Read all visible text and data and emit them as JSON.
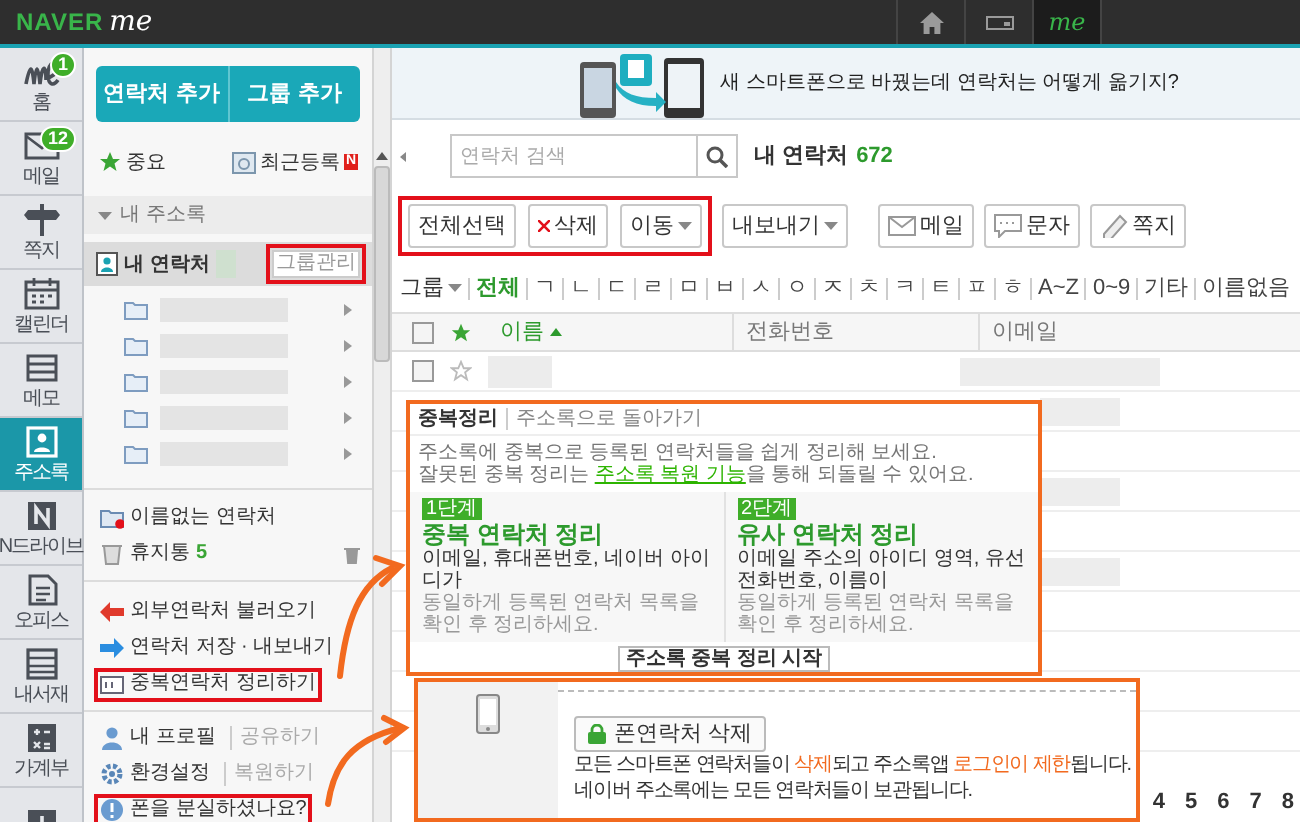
{
  "top_bar": {
    "logo": "NAVER",
    "logo_mark": "me",
    "nav": [
      {
        "kind": "home",
        "selected": false
      },
      {
        "kind": "card",
        "selected": false
      },
      {
        "kind": "me",
        "label": "me",
        "selected": true
      }
    ]
  },
  "nav_rail": [
    {
      "kind": "me",
      "label": "홈",
      "badge": "1",
      "selected": false
    },
    {
      "kind": "mail",
      "label": "메일",
      "badge": "12",
      "selected": false
    },
    {
      "kind": "note",
      "label": "쪽지",
      "selected": false
    },
    {
      "kind": "calendar",
      "label": "캘린더",
      "selected": false
    },
    {
      "kind": "memo",
      "label": "메모",
      "selected": false
    },
    {
      "kind": "contacts",
      "label": "주소록",
      "selected": true
    },
    {
      "kind": "drive",
      "label": "N드라이브",
      "selected": false
    },
    {
      "kind": "office",
      "label": "오피스",
      "selected": false
    },
    {
      "kind": "library",
      "label": "내서재",
      "selected": false
    },
    {
      "kind": "ledger",
      "label": "가계부",
      "selected": false
    },
    {
      "kind": "plus",
      "selected": false
    }
  ],
  "sidebar": {
    "buttons": [
      "연락처 추가",
      "그룹 추가"
    ],
    "quick": [
      {
        "kind": "star",
        "label": "중요"
      },
      {
        "kind": "recent",
        "label": "최근등록",
        "badge": "N"
      }
    ],
    "address_book": {
      "title": "내 주소록",
      "expanded": true,
      "items": [
        {
          "label": "내 연락처",
          "selected": true,
          "action": "그룹관리",
          "highlighted": true
        }
      ],
      "groups": [
        {
          "kind": "blurred"
        },
        {
          "kind": "blurred"
        },
        {
          "kind": "blurred"
        },
        {
          "kind": "blurred"
        },
        {
          "kind": "blurred"
        }
      ]
    },
    "special": [
      {
        "kind": "unnamed",
        "label": "이름없는 연락처"
      },
      {
        "kind": "trash",
        "label": "휴지통",
        "count": "5"
      }
    ],
    "tools": [
      {
        "kind": "import",
        "label": "외부연락처 불러오기",
        "highlighted": false
      },
      {
        "kind": "export",
        "label": "연락처 저장 · 내보내기",
        "highlighted": false
      },
      {
        "kind": "dedupe",
        "label": "중복연락처 정리하기",
        "highlighted": true
      }
    ],
    "settings": [
      {
        "kind": "profile",
        "label": "내 프로필",
        "link": "공유하기",
        "highlighted": false
      },
      {
        "kind": "settings",
        "label": "환경설정",
        "link": "복원하기",
        "highlighted": false
      },
      {
        "kind": "lost",
        "label": "폰을 분실하셨나요?",
        "highlighted": true
      }
    ]
  },
  "banner": {
    "text": "새 스마트폰으로 바꿨는데 연락처는 어떻게 옮기지?"
  },
  "search": {
    "placeholder": "연락처 검색"
  },
  "list_title": "내 연락처",
  "count": "672",
  "toolbar": [
    {
      "kind": "text",
      "label": "전체선택",
      "highlighted": true
    },
    {
      "kind": "delete",
      "label": "삭제",
      "highlighted": true
    },
    {
      "kind": "dropdown",
      "label": "이동",
      "highlighted": true
    },
    {
      "kind": "dropdown",
      "label": "내보내기",
      "highlighted": false
    },
    {
      "kind": "mail",
      "label": "메일",
      "highlighted": false
    },
    {
      "kind": "sms",
      "label": "문자",
      "highlighted": false
    },
    {
      "kind": "note",
      "label": "쪽지",
      "highlighted": false
    }
  ],
  "index_filter": {
    "group": "그룹",
    "items": [
      {
        "label": "전체",
        "selected": true
      },
      {
        "label": "ㄱ",
        "selected": false
      },
      {
        "label": "ㄴ",
        "selected": false
      },
      {
        "label": "ㄷ",
        "selected": false
      },
      {
        "label": "ㄹ",
        "selected": false
      },
      {
        "label": "ㅁ",
        "selected": false
      },
      {
        "label": "ㅂ",
        "selected": false
      },
      {
        "label": "ㅅ",
        "selected": false
      },
      {
        "label": "ㅇ",
        "selected": false
      },
      {
        "label": "ㅈ",
        "selected": false
      },
      {
        "label": "ㅊ",
        "selected": false
      },
      {
        "label": "ㅋ",
        "selected": false
      },
      {
        "label": "ㅌ",
        "selected": false
      },
      {
        "label": "ㅍ",
        "selected": false
      },
      {
        "label": "ㅎ",
        "selected": false
      },
      {
        "label": "A~Z",
        "selected": false
      },
      {
        "label": "0~9",
        "selected": false
      },
      {
        "label": "기타",
        "selected": false
      },
      {
        "label": "이름없음",
        "selected": false
      }
    ]
  },
  "table": {
    "all_checked": false,
    "columns": [
      {
        "label": "이름",
        "sorted": true
      },
      {
        "label": "전화번호",
        "sorted": false
      },
      {
        "label": "이메일",
        "sorted": false
      }
    ],
    "rows": [
      {
        "checked": false,
        "starred": false
      }
    ]
  },
  "pagination": [
    "4",
    "5",
    "6",
    "7",
    "8"
  ],
  "dedupe_panel": {
    "title": "중복정리",
    "back_link": "주소록으로 돌아가기",
    "notes": [
      {
        "text": "주소록에 중복으로 등록된 연락처들을 쉽게 정리해 보세요."
      },
      {
        "text": "잘못된 중복 정리는 ",
        "link": "주소록 복원 기능",
        "after": "을 통해 되돌릴 수 있어요."
      }
    ],
    "steps": [
      {
        "step": "1단계",
        "title": "중복 연락처 정리",
        "criteria": "이메일, 휴대폰번호, 네이버 아이디가",
        "hint": "동일하게 등록된 연락처 목록을 확인 후 정리하세요."
      },
      {
        "step": "2단계",
        "title": "유사 연락처 정리",
        "criteria": "이메일 주소의 아이디 영역, 유선전화번호, 이름이",
        "hint": "동일하게 등록된 연락처 목록을 확인 후 정리하세요."
      }
    ],
    "button": "주소록 중복 정리 시작"
  },
  "lost_phone_panel": {
    "button": "폰연락처 삭제",
    "notes": [
      "모든 스마트폰 연락처들이 **삭제**되고 주소록앱 **로그인이 제한**됩니다.",
      "네이버 주소록에는 모든 연락처들이 보관됩니다."
    ]
  }
}
